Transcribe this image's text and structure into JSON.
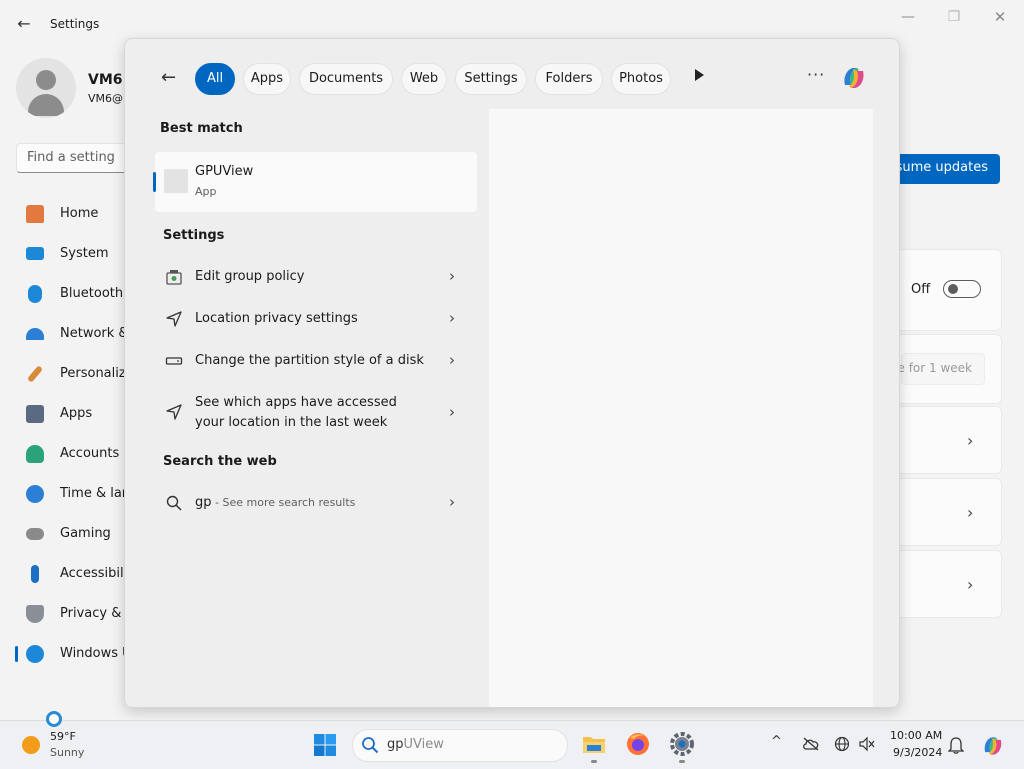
{
  "window": {
    "title": "Settings",
    "back_glyph": "←",
    "minimize_glyph": "—",
    "maximize_glyph": "❐",
    "close_glyph": "✕"
  },
  "user": {
    "name": "VM6",
    "email": "VM6@"
  },
  "find_setting": {
    "placeholder": "Find a setting"
  },
  "nav": {
    "items": [
      {
        "label": "Home",
        "icon": "home-icon",
        "color": "#e27a3f"
      },
      {
        "label": "System",
        "icon": "system-icon",
        "color": "#1e88d8"
      },
      {
        "label": "Bluetooth",
        "icon": "bluetooth-icon",
        "color": "#1e88d8"
      },
      {
        "label": "Network &",
        "icon": "network-icon",
        "color": "#2b7fd4"
      },
      {
        "label": "Personaliza",
        "icon": "brush-icon",
        "color": "#d88c3a"
      },
      {
        "label": "Apps",
        "icon": "apps-icon",
        "color": "#5a6a80"
      },
      {
        "label": "Accounts",
        "icon": "accounts-icon",
        "color": "#2aa37a"
      },
      {
        "label": "Time & lar",
        "icon": "time-icon",
        "color": "#2b7fd4"
      },
      {
        "label": "Gaming",
        "icon": "gaming-icon",
        "color": "#8a8a8a"
      },
      {
        "label": "Accessibili",
        "icon": "accessibility-icon",
        "color": "#1e6fc4"
      },
      {
        "label": "Privacy & s",
        "icon": "shield-icon",
        "color": "#8a8f97"
      },
      {
        "label": "Windows U",
        "icon": "windows-update-icon",
        "color": "#1e88d8"
      }
    ]
  },
  "main": {
    "resume_button": "esume updates",
    "toggle_off_label": "Off",
    "pause_label": "e for 1 week",
    "chevron": "›"
  },
  "flyout": {
    "back_glyph": "←",
    "filters": [
      "All",
      "Apps",
      "Documents",
      "Web",
      "Settings",
      "Folders",
      "Photos"
    ],
    "more_glyph": "···",
    "best_match_heading": "Best match",
    "best_match": {
      "title": "GPUView",
      "subtitle": "App"
    },
    "settings_heading": "Settings",
    "settings_results": [
      {
        "label": "Edit group policy",
        "icon": "group-policy-icon"
      },
      {
        "label": "Location privacy settings",
        "icon": "location-icon"
      },
      {
        "label": "Change the partition style of a disk",
        "icon": "disk-icon"
      },
      {
        "label_line1": "See which apps have accessed",
        "label_line2": "your location in the last week",
        "icon": "location-icon"
      }
    ],
    "web_heading": "Search the web",
    "web_result": {
      "query": "gp",
      "hint": " - See more search results"
    },
    "chevron": "›"
  },
  "taskbar": {
    "weather_temp": "59°F",
    "weather_cond": "Sunny",
    "search_typed": "gp",
    "search_completion": "UView",
    "time": "10:00 AM",
    "date": "9/3/2024",
    "tray_chevron": "^"
  },
  "colors": {
    "accent": "#0067c0",
    "page_bg": "#f3f3f3",
    "flyout_bg": "#eeeeee"
  }
}
